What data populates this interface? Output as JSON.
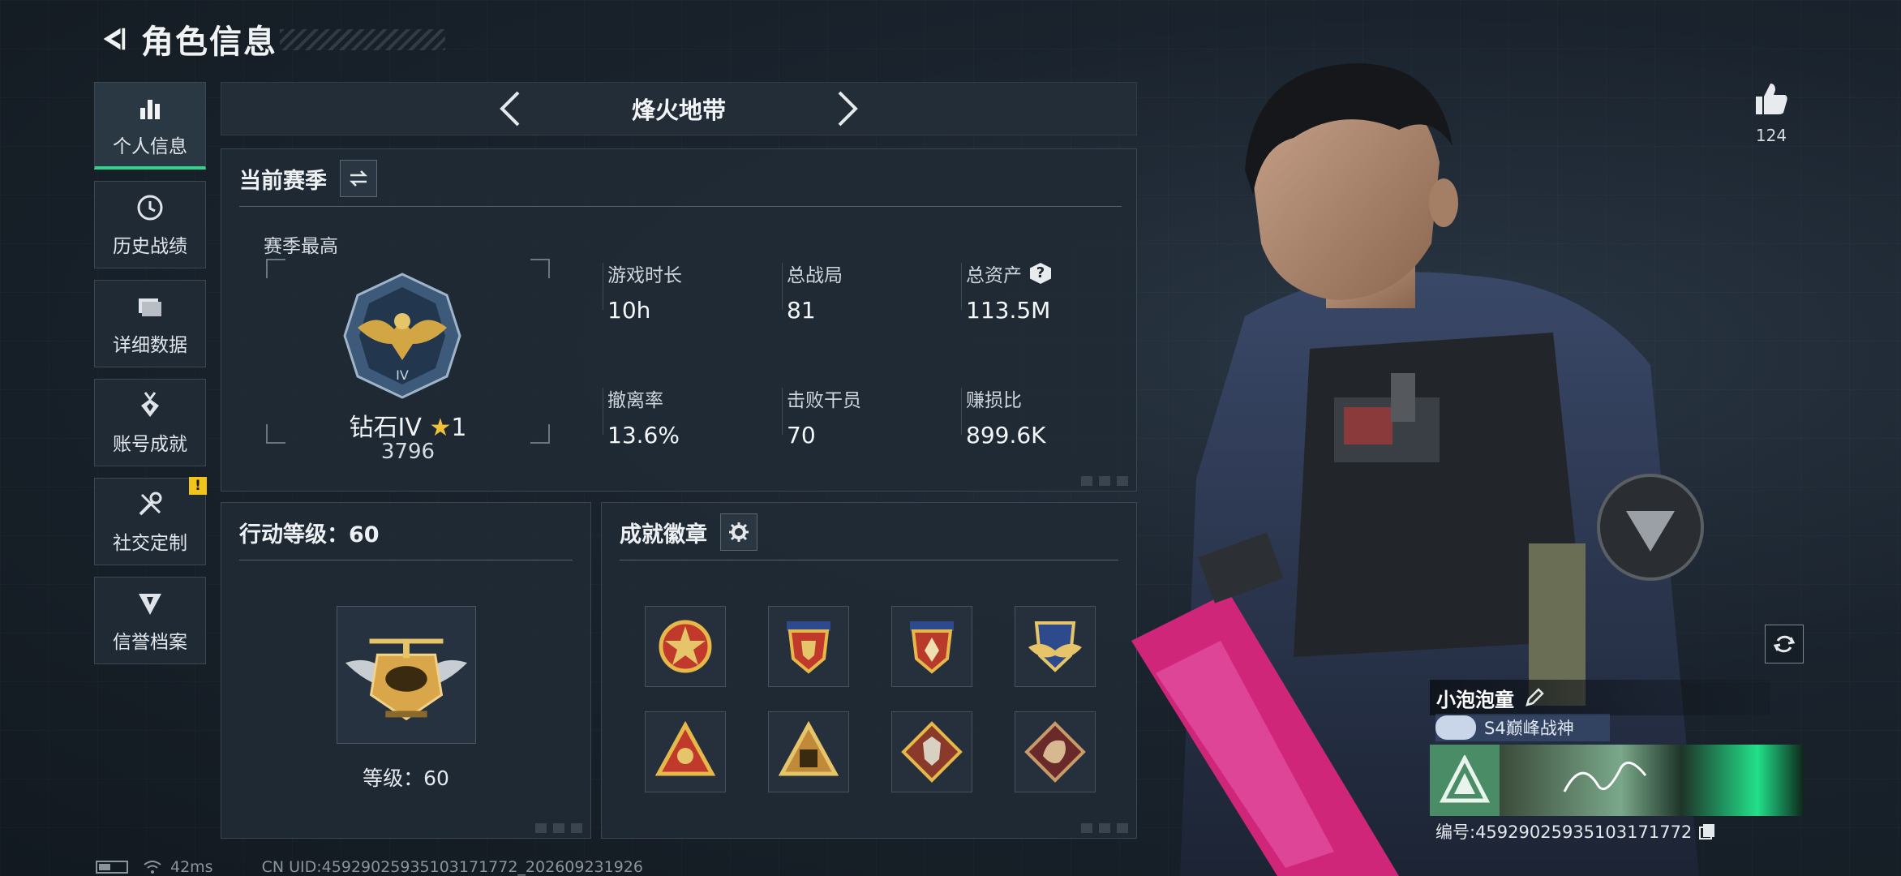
{
  "header": {
    "title": "角色信息"
  },
  "nav": {
    "items": [
      {
        "label": "个人信息",
        "icon": "bar-chart-icon",
        "active": true
      },
      {
        "label": "历史战绩",
        "icon": "history-clock-icon"
      },
      {
        "label": "详细数据",
        "icon": "folder-icon"
      },
      {
        "label": "账号成就",
        "icon": "medal-icon"
      },
      {
        "label": "社交定制",
        "icon": "wrench-screwdriver-icon",
        "badge": "!"
      },
      {
        "label": "信誉档案",
        "icon": "shield-emblem-icon"
      }
    ]
  },
  "mode": {
    "title": "烽火地带"
  },
  "season": {
    "title": "当前赛季",
    "best_label": "赛季最高",
    "rank_name": "钻石IV",
    "rank_stars": "1",
    "rank_score": "3796",
    "stats": [
      {
        "label": "游戏时长",
        "value": "10h"
      },
      {
        "label": "总战局",
        "value": "81"
      },
      {
        "label": "总资产",
        "value": "113.5M"
      },
      {
        "label": "撤离率",
        "value": "13.6%"
      },
      {
        "label": "击败干员",
        "value": "70"
      },
      {
        "label": "赚损比",
        "value": "899.6K"
      }
    ],
    "help_icon_text": "?"
  },
  "level": {
    "title": "行动等级：60",
    "label": "等级：60"
  },
  "achievements": {
    "title": "成就徽章",
    "badges": [
      "star-medal-icon",
      "shield-medal-icon",
      "shield-medal-red-icon",
      "wing-shield-icon",
      "triangle-badge-icon",
      "bag-triangle-icon",
      "wolf-badge-icon",
      "dragon-badge-icon"
    ]
  },
  "likes": {
    "count": "124"
  },
  "profile": {
    "name": "小泡泡童",
    "title": "S4巅峰战神",
    "uid_label": "编号:4592902593510317177​2",
    "uid": "编号:45929025935103171772"
  },
  "statusbar": {
    "ping": "42ms",
    "uid": "CN UID:45929025935103171772_202609231926"
  },
  "colors": {
    "accent": "#2fd68a",
    "gold": "#f0c23a",
    "warn": "#f2c31a"
  }
}
